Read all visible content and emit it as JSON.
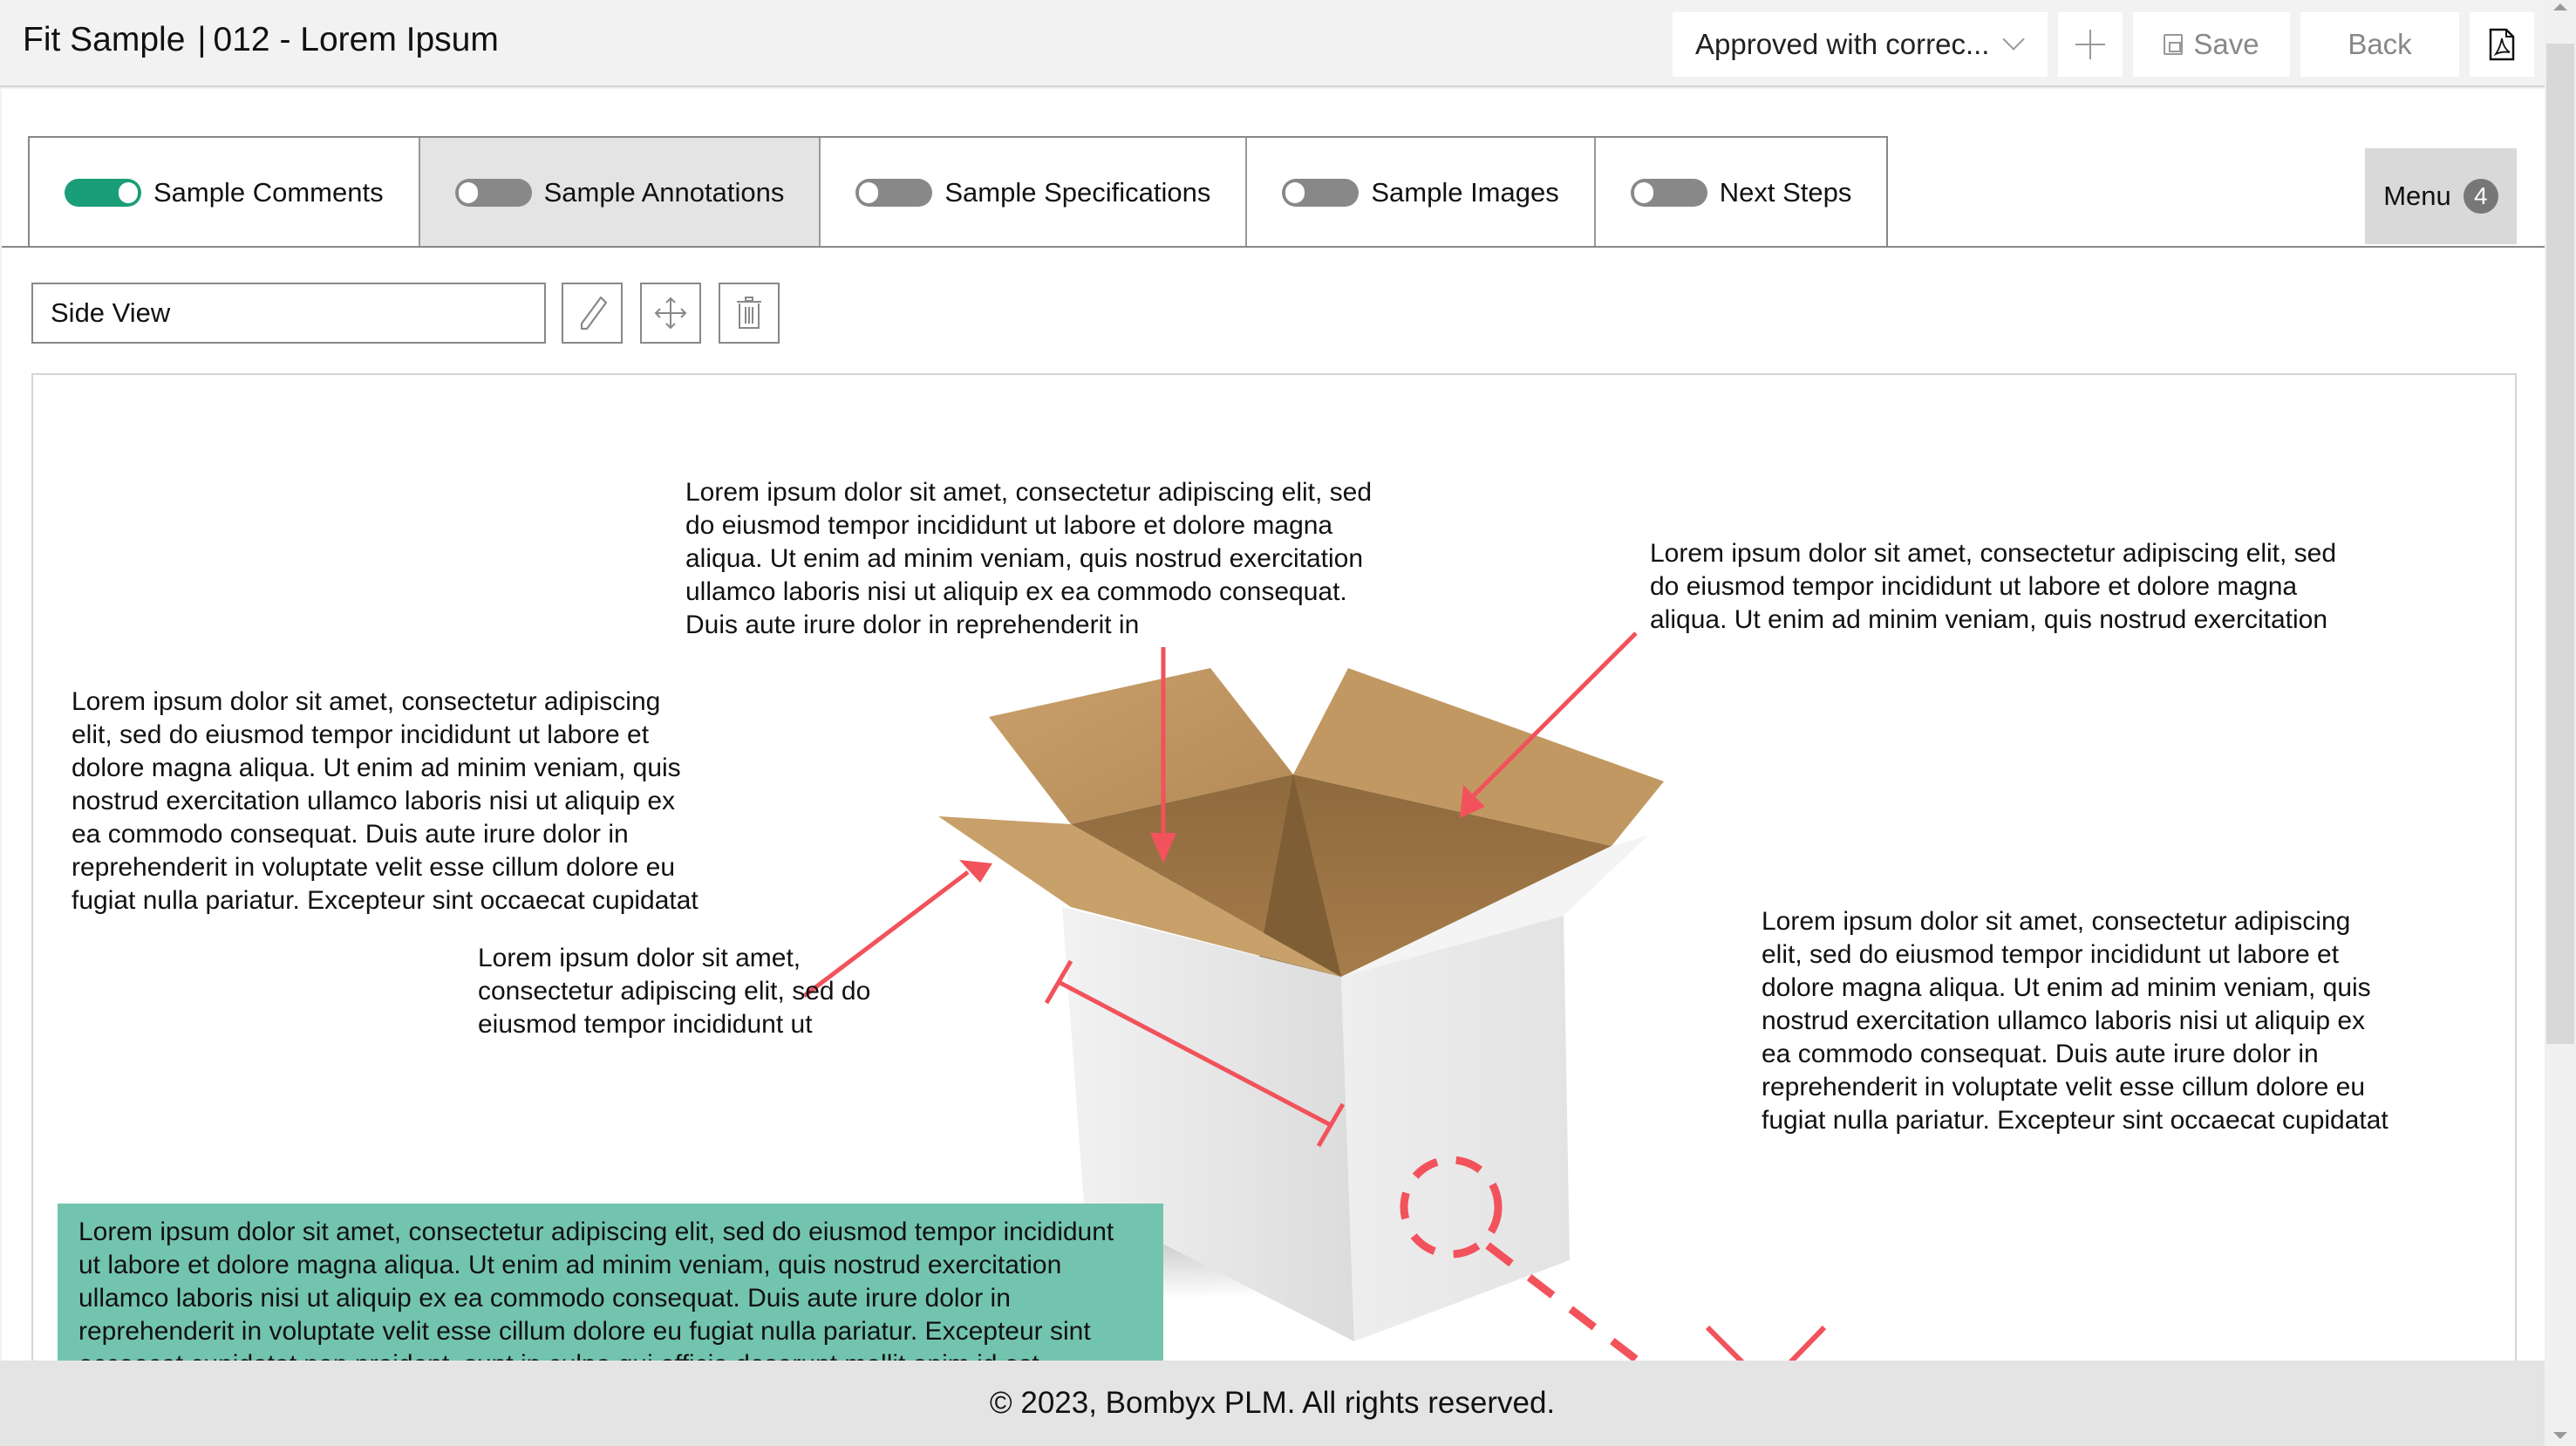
{
  "header": {
    "title": "Fit Sample",
    "separator": "|",
    "sample_id": "012 - Lorem Ipsum",
    "status_select": {
      "value": "Approved with correc...",
      "icon": "chevron-down-icon"
    },
    "add_icon": "plus-icon",
    "save_label": "Save",
    "save_icon": "floppy-disk-icon",
    "back_label": "Back",
    "pdf_icon": "pdf-file-icon"
  },
  "tabs": [
    {
      "label": "Sample Comments",
      "toggle_on": true,
      "active": false
    },
    {
      "label": "Sample Annotations",
      "toggle_on": false,
      "active": true
    },
    {
      "label": "Sample Specifications",
      "toggle_on": false,
      "active": false
    },
    {
      "label": "Sample Images",
      "toggle_on": false,
      "active": false
    },
    {
      "label": "Next Steps",
      "toggle_on": false,
      "active": false
    }
  ],
  "menu": {
    "label": "Menu",
    "badge": "4"
  },
  "view": {
    "name_value": "Side View",
    "tools": [
      "pencil-icon",
      "move-arrows-icon",
      "trash-icon"
    ]
  },
  "annotations": {
    "top": "Lorem ipsum dolor sit amet, consectetur adipiscing elit, sed do eiusmod tempor incididunt ut labore et dolore magna aliqua. Ut enim ad minim veniam, quis nostrud exercitation ullamco laboris nisi ut aliquip ex ea commodo consequat. Duis aute irure dolor in reprehenderit in",
    "top_right": "Lorem ipsum dolor sit amet, consectetur adipiscing elit, sed do eiusmod tempor incididunt ut labore et dolore magna aliqua. Ut enim ad minim veniam, quis nostrud exercitation",
    "left": "Lorem ipsum dolor sit amet, consectetur adipiscing elit, sed do eiusmod tempor incididunt ut labore et dolore magna aliqua. Ut enim ad minim veniam, quis nostrud exercitation ullamco laboris nisi ut aliquip ex ea commodo consequat. Duis aute irure dolor in reprehenderit in voluptate velit esse cillum dolore eu fugiat nulla pariatur. Excepteur sint occaecat cupidatat",
    "middle": "Lorem ipsum dolor sit amet, consectetur adipiscing elit, sed do eiusmod tempor incididunt ut",
    "right": "Lorem ipsum dolor sit amet, consectetur adipiscing elit, sed do eiusmod tempor incididunt ut labore et dolore magna aliqua. Ut enim ad minim veniam, quis nostrud exercitation ullamco laboris nisi ut aliquip ex ea commodo consequat. Duis aute irure dolor in reprehenderit in voluptate velit esse cillum dolore eu fugiat nulla pariatur. Excepteur sint occaecat cupidatat",
    "highlight": "Lorem ipsum dolor sit amet, consectetur adipiscing elit, sed do eiusmod tempor incididunt ut labore et dolore magna aliqua. Ut enim ad minim veniam, quis nostrud exercitation ullamco laboris nisi ut aliquip ex ea commodo consequat. Duis aute irure dolor in reprehenderit in voluptate velit esse cillum dolore eu fugiat nulla pariatur. Excepteur sint occaecat cupidatat non proident, sunt in culpa qui officia deserunt mollit anim id est laborum."
  },
  "image": {
    "subject": "open cardboard box"
  },
  "colors": {
    "accent_green": "#1a9e78",
    "highlight_green": "#73c4ae",
    "annotation_red": "#f2525b"
  },
  "footer": {
    "text": "© 2023, Bombyx PLM. All rights reserved."
  }
}
